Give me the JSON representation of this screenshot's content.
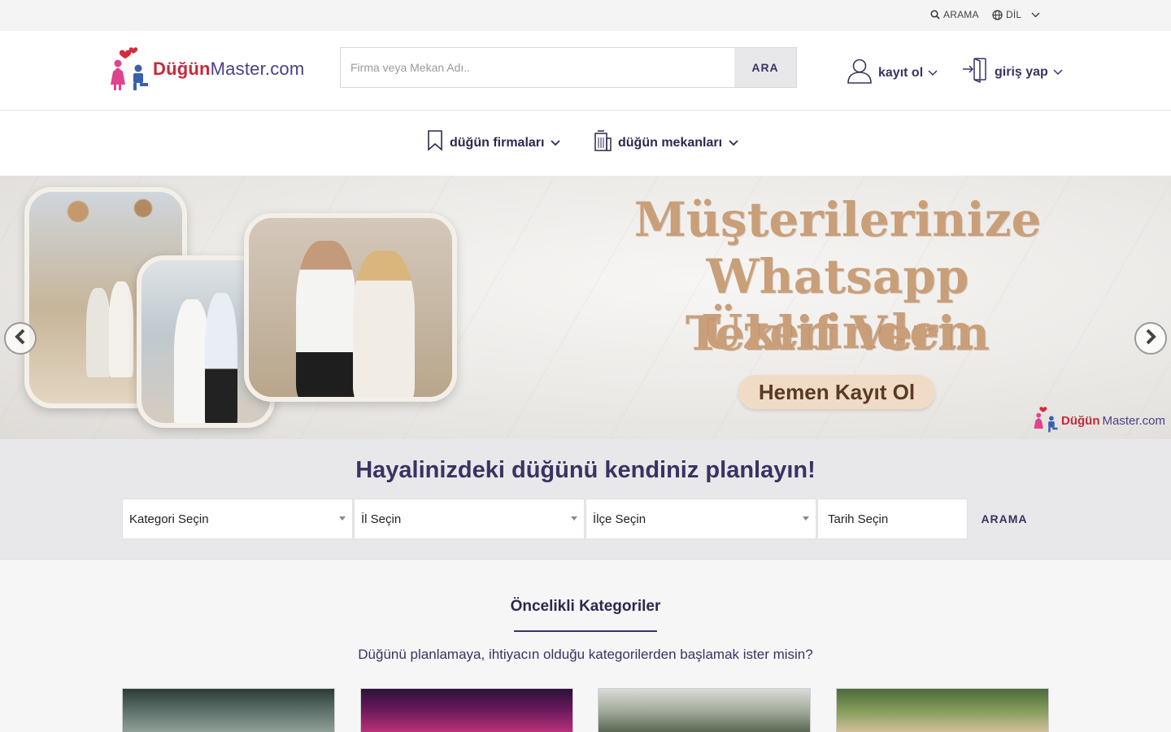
{
  "topbar": {
    "search_label": "ARAMA",
    "lang_label": "DİL"
  },
  "header": {
    "logo": {
      "brand": "Düğün",
      "rest": "Master.com"
    },
    "search": {
      "placeholder": "Firma veya Mekan Adı..",
      "button_label": "ARA"
    },
    "register_label": "kayıt ol",
    "login_label": "giriş yap"
  },
  "nav": {
    "items": [
      {
        "label": "düğün firmaları",
        "icon": "bookmark-icon"
      },
      {
        "label": "düğün mekanları",
        "icon": "building-icon"
      }
    ]
  },
  "hero": {
    "line1": "Müşterilerinize",
    "line2": "Whatsapp Üzerinden",
    "line3": "Teklif Verin",
    "cta": "Hemen Kayıt Ol",
    "logo": {
      "brand": "Düğün",
      "rest": "Master.com"
    },
    "colors": {
      "headline": "#c99f7a",
      "cta_bg": "#f0dcc6"
    }
  },
  "planner": {
    "title": "Hayalinizdeki düğünü kendiniz planlayın!",
    "category_placeholder": "Kategori Seçin",
    "province_placeholder": "İl Seçin",
    "district_placeholder": "İlçe Seçin",
    "date_placeholder": "Tarih Seçin",
    "submit_label": "ARAMA"
  },
  "priority": {
    "title": "Öncelikli Kategoriler",
    "subtitle": "Düğünü planlamaya, ihtiyacın olduğu kategorilerden başlamak ister misin?"
  },
  "theme": {
    "primary": "#3b3262",
    "brand_red": "#c8283a",
    "brand_purple": "#4b3f86"
  }
}
